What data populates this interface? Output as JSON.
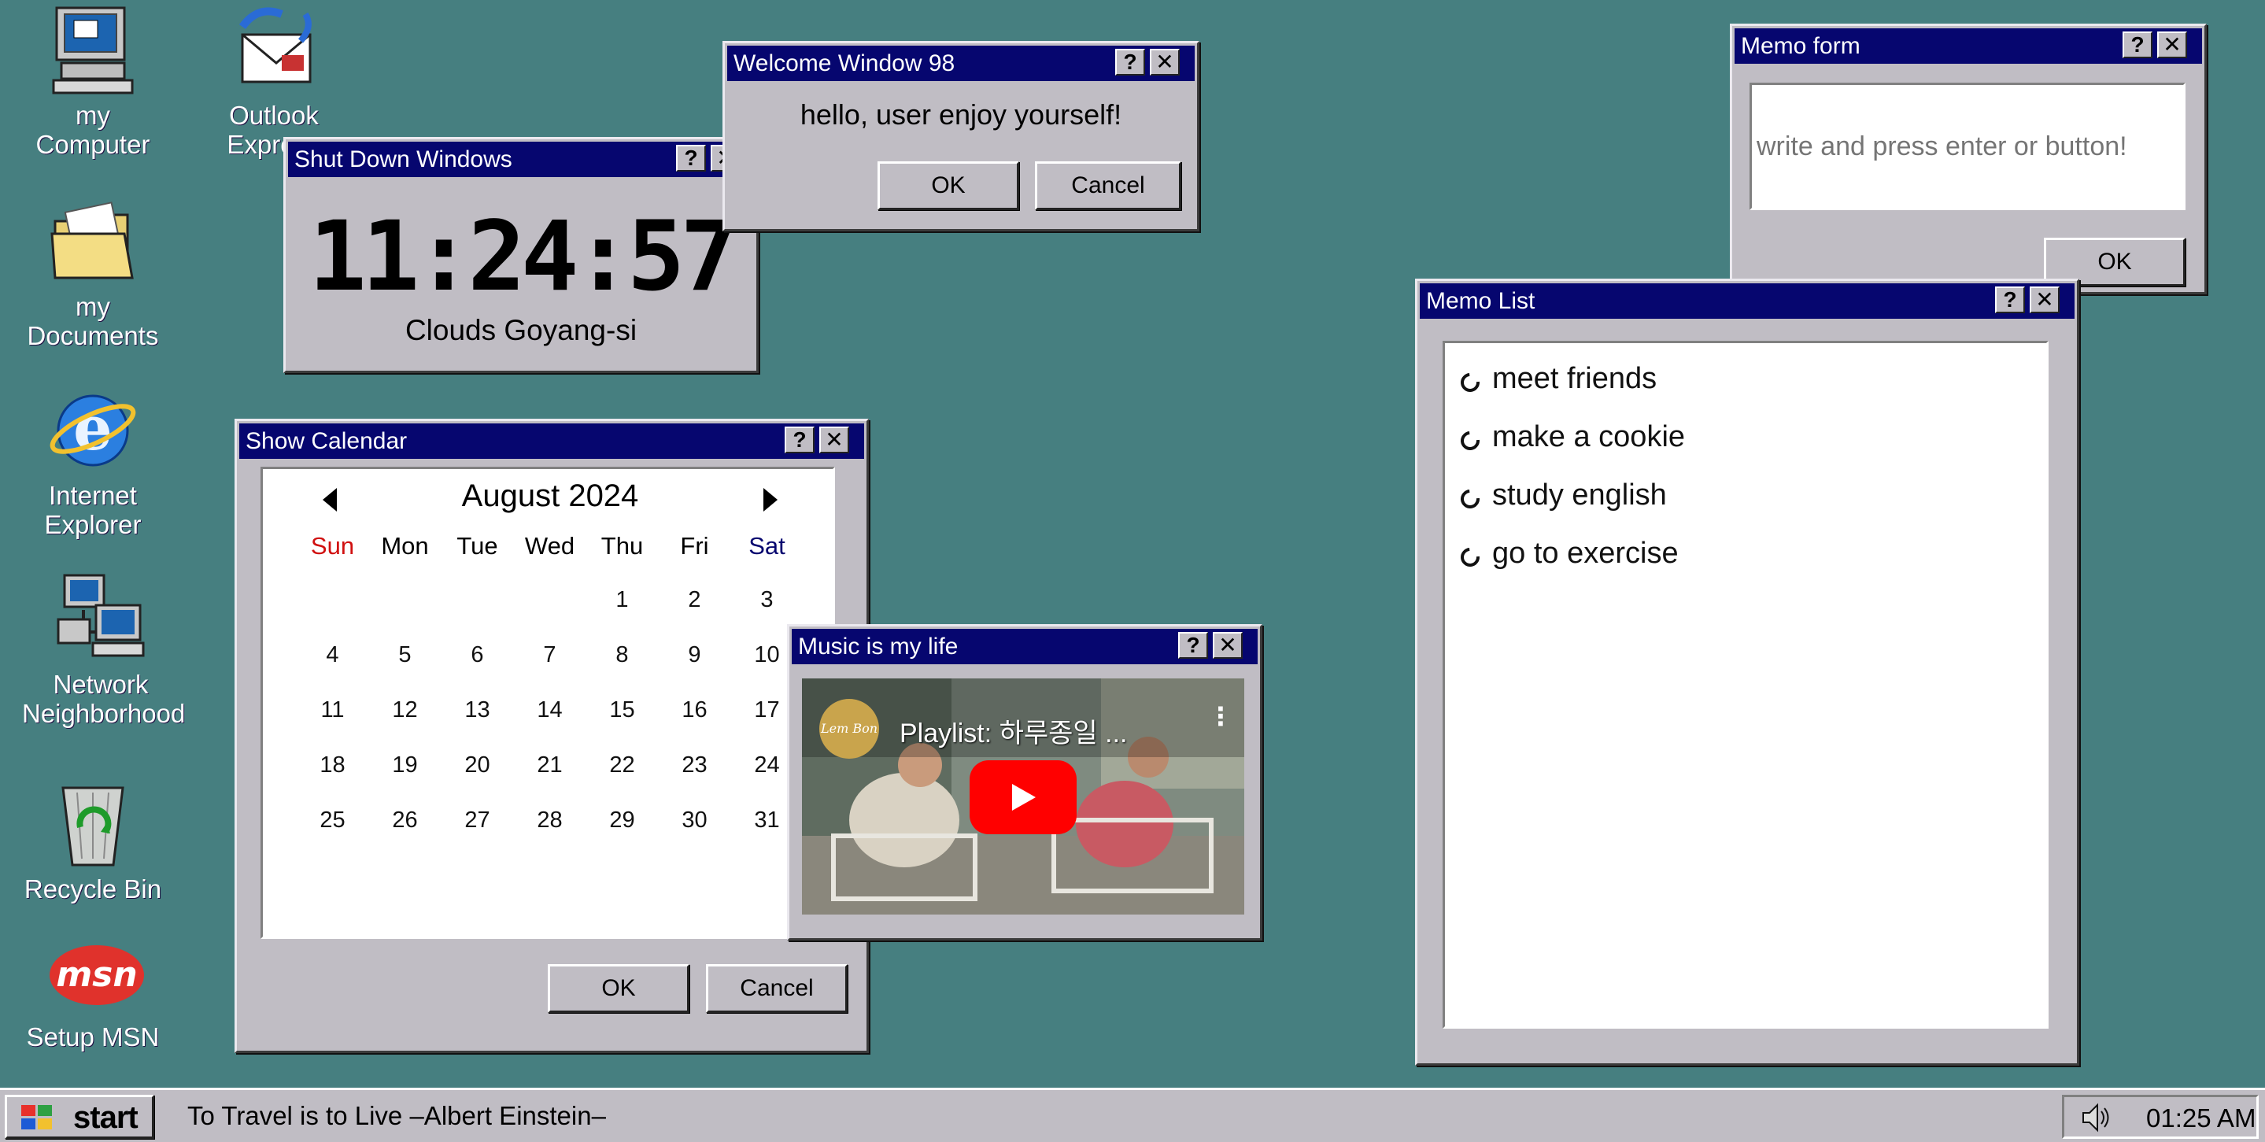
{
  "desktop": {
    "icons": [
      {
        "line1": "my",
        "line2": "Computer"
      },
      {
        "line1": "Outlook",
        "line2": "Express"
      },
      {
        "line1": "my",
        "line2": "Documents"
      },
      {
        "line1": "Internet",
        "line2": "Explorer"
      },
      {
        "line1": "Network",
        "line2": "Neighborhood"
      },
      {
        "line1": "Recycle Bin",
        "line2": ""
      },
      {
        "line1": "Setup MSN",
        "line2": ""
      }
    ]
  },
  "clock_window": {
    "title": "Shut Down Windows",
    "time": "11:24:57",
    "weather": "Clouds Goyang-si"
  },
  "welcome_window": {
    "title": "Welcome Window 98",
    "message": "hello, user enjoy yourself!",
    "ok_label": "OK",
    "cancel_label": "Cancel"
  },
  "calendar_window": {
    "title": "Show Calendar",
    "month_label": "August 2024",
    "weekdays": [
      "Sun",
      "Mon",
      "Tue",
      "Wed",
      "Thu",
      "Fri",
      "Sat"
    ],
    "weeks": [
      [
        "",
        "",
        "",
        "",
        "1",
        "2",
        "3"
      ],
      [
        "4",
        "5",
        "6",
        "7",
        "8",
        "9",
        "10"
      ],
      [
        "11",
        "12",
        "13",
        "14",
        "15",
        "16",
        "17"
      ],
      [
        "18",
        "19",
        "20",
        "21",
        "22",
        "23",
        "24"
      ],
      [
        "25",
        "26",
        "27",
        "28",
        "29",
        "30",
        "31"
      ]
    ],
    "ok_label": "OK",
    "cancel_label": "Cancel"
  },
  "music_window": {
    "title": "Music is my life",
    "video_title": "Playlist: 하루종일 ...",
    "channel_logo_text": "Lem Bon"
  },
  "memo_form": {
    "title": "Memo form",
    "placeholder": "write and press enter or button!",
    "ok_label": "OK"
  },
  "memo_list": {
    "title": "Memo List",
    "items": [
      "meet friends",
      "make a cookie",
      "study english",
      "go to exercise"
    ]
  },
  "taskbar": {
    "start_label": "start",
    "quote": "To Travel is to Live –Albert Einstein–",
    "clock": "01:25 AM"
  },
  "colors": {
    "desktop": "#467f80",
    "titlebar": "#06066f",
    "window": "#c0bdc4",
    "sunday": "#d01010",
    "saturday": "#06066f"
  },
  "icon_names": [
    "computer-icon",
    "outlook-icon",
    "folder-icon",
    "internet-explorer-icon",
    "network-icon",
    "recycle-bin-icon",
    "msn-icon",
    "windows-logo-icon",
    "speaker-icon",
    "play-icon"
  ]
}
